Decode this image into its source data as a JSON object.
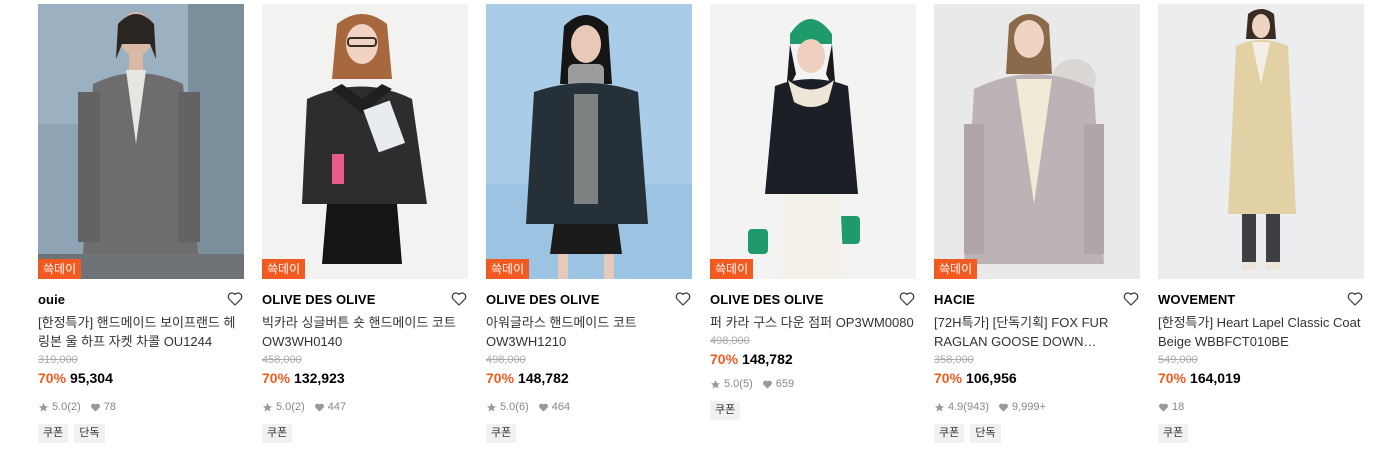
{
  "heart_icon": "heart-outline-icon",
  "star_icon": "star-icon",
  "like_icon": "heart-filled-icon",
  "accent_color": "#f35a21",
  "products": [
    {
      "badge": "쓱데이",
      "brand": "ouie",
      "title": "[한정특가] 핸드메이드 보이프랜드 헤링본 울 하프 자켓 차콜 OU1244",
      "original_price": "319,000",
      "discount": "70%",
      "price": "95,304",
      "rating": "5.0",
      "reviews": "(2)",
      "likes": "78",
      "tags": [
        "쿠폰",
        "단독"
      ]
    },
    {
      "badge": "쓱데이",
      "brand": "OLIVE DES OLIVE",
      "title": "빅카라 싱글버튼 숏 핸드메이드 코트 OW3WH0140",
      "original_price": "458,000",
      "discount": "70%",
      "price": "132,923",
      "rating": "5.0",
      "reviews": "(2)",
      "likes": "447",
      "tags": [
        "쿠폰"
      ]
    },
    {
      "badge": "쓱데이",
      "brand": "OLIVE DES OLIVE",
      "title": "아워글라스 핸드메이드 코트 OW3WH1210",
      "original_price": "498,000",
      "discount": "70%",
      "price": "148,782",
      "rating": "5.0",
      "reviews": "(6)",
      "likes": "464",
      "tags": [
        "쿠폰"
      ]
    },
    {
      "badge": "쓱데이",
      "brand": "OLIVE DES OLIVE",
      "title": "퍼 카라 구스 다운 점퍼 OP3WM0080",
      "original_price": "498,000",
      "discount": "70%",
      "price": "148,782",
      "rating": "5.0",
      "reviews": "(5)",
      "likes": "659",
      "tags": [
        "쿠폰"
      ]
    },
    {
      "badge": "쓱데이",
      "brand": "HACIE",
      "title": "[72H특가] [단독기획] FOX FUR RAGLAN GOOSE DOWN JUMPER…",
      "original_price": "358,000",
      "discount": "70%",
      "price": "106,956",
      "rating": "4.9",
      "reviews": "(943)",
      "likes": "9,999+",
      "tags": [
        "쿠폰",
        "단독"
      ]
    },
    {
      "badge": "",
      "brand": "WOVEMENT",
      "title": "[한정특가] Heart Lapel Classic Coat Beige WBBFCT010BE",
      "original_price": "549,000",
      "discount": "70%",
      "price": "164,019",
      "rating": "",
      "reviews": "",
      "likes": "18",
      "tags": [
        "쿠폰"
      ]
    }
  ]
}
